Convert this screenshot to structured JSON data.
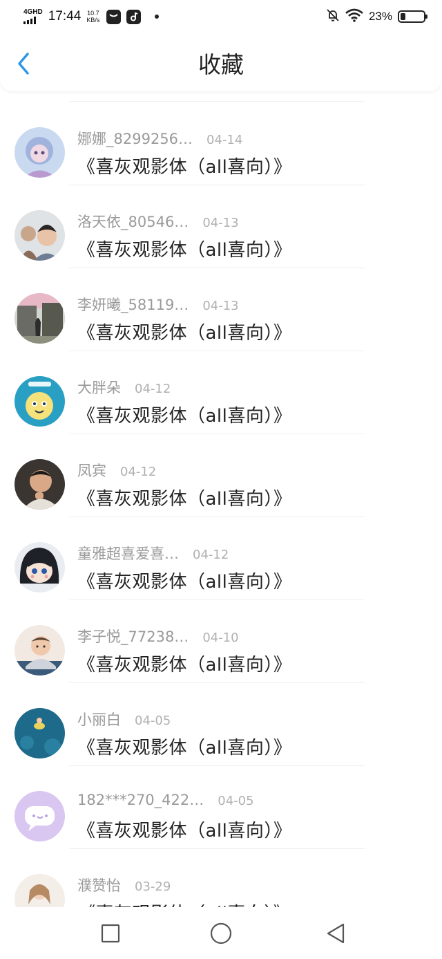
{
  "status_bar": {
    "network": "4GHD",
    "time": "17:44",
    "speed_value": "10.7",
    "speed_unit": "KB/s",
    "battery_percent": "23%",
    "battery_level": 0.23
  },
  "header": {
    "title": "收藏"
  },
  "icons": {
    "back": "chevron-left-icon",
    "home": "circle-home-icon",
    "recents": "square-recents-icon",
    "nav_back": "triangle-back-icon",
    "mute": "bell-off-icon",
    "wifi": "wifi-icon",
    "battery": "battery-icon"
  },
  "colors": {
    "accent": "#2a96e6",
    "username": "#9a9a9a",
    "date": "#b0b0b0",
    "title": "#222222"
  },
  "favorites": [
    {
      "user": "娜娜_8299256…",
      "date": "04-14",
      "title": "《喜灰观影体（all喜向）》"
    },
    {
      "user": "洛天依_80546…",
      "date": "04-13",
      "title": "《喜灰观影体（all喜向）》"
    },
    {
      "user": "李妍曦_58119…",
      "date": "04-13",
      "title": "《喜灰观影体（all喜向）》"
    },
    {
      "user": "大胖朵",
      "date": "04-12",
      "title": "《喜灰观影体（all喜向）》"
    },
    {
      "user": "凤宾",
      "date": "04-12",
      "title": "《喜灰观影体（all喜向）》"
    },
    {
      "user": "童雅超喜爱喜…",
      "date": "04-12",
      "title": "《喜灰观影体（all喜向）》"
    },
    {
      "user": "李子悦_77238…",
      "date": "04-10",
      "title": "《喜灰观影体（all喜向）》"
    },
    {
      "user": "小丽白",
      "date": "04-05",
      "title": "《喜灰观影体（all喜向）》"
    },
    {
      "user": "182***270_422…",
      "date": "04-05",
      "title": "《喜灰观影体（all喜向）》"
    },
    {
      "user": "濮赞怡",
      "date": "03-29",
      "title": "《喜灰观影体（all喜向）》"
    }
  ]
}
